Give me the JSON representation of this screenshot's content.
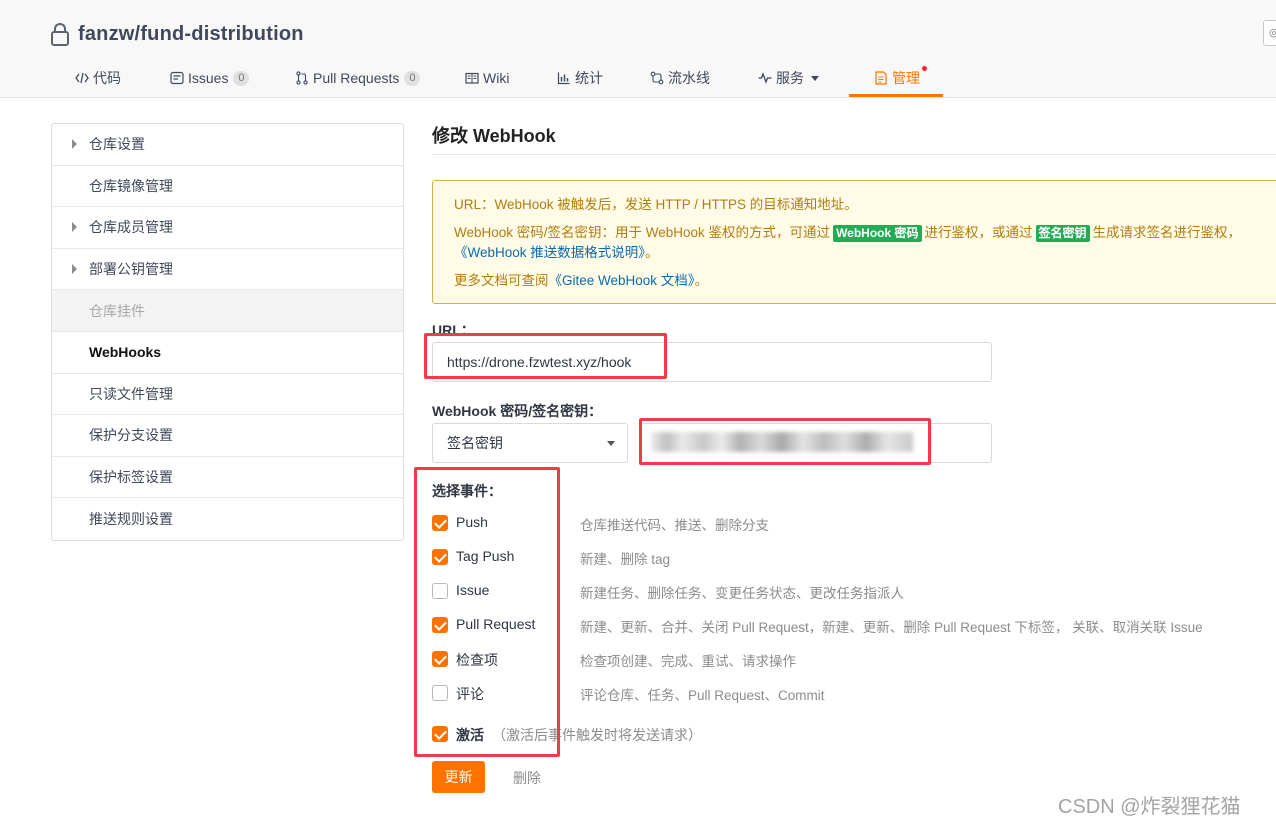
{
  "repo": {
    "name": "fanzw/fund-distribution"
  },
  "top_right": {
    "glyph": "◎"
  },
  "nav": [
    {
      "label": "代码",
      "icon": "code-icon"
    },
    {
      "label": "Issues",
      "icon": "issues-icon",
      "badge": "0"
    },
    {
      "label": "Pull Requests",
      "icon": "pull-request-icon",
      "badge": "0"
    },
    {
      "label": "Wiki",
      "icon": "wiki-icon"
    },
    {
      "label": "统计",
      "icon": "stats-icon"
    },
    {
      "label": "流水线",
      "icon": "pipeline-icon"
    },
    {
      "label": "服务",
      "icon": "service-icon"
    },
    {
      "label": "管理",
      "icon": "manage-icon"
    }
  ],
  "colors": {
    "accent": "#fe7300",
    "highlight_box": "#ef3b4a",
    "badge_green": "#22ad55"
  },
  "sidebar": [
    {
      "label": "仓库设置"
    },
    {
      "label": "仓库镜像管理"
    },
    {
      "label": "仓库成员管理"
    },
    {
      "label": "部署公钥管理"
    },
    {
      "label": "仓库挂件"
    },
    {
      "label": "WebHooks"
    },
    {
      "label": "只读文件管理"
    },
    {
      "label": "保护分支设置"
    },
    {
      "label": "保护标签设置"
    },
    {
      "label": "推送规则设置"
    }
  ],
  "main": {
    "title": "修改 WebHook",
    "notice": {
      "line1": "URL：WebHook 被触发后，发送 HTTP / HTTPS 的目标通知地址。",
      "line2_a": "WebHook 密码/签名密钥：用于 WebHook 鉴权的方式，可通过",
      "badge1": "WebHook 密码",
      "line2_b": "进行鉴权，或通过",
      "badge2": "签名密钥",
      "line2_c": "生成请求签名进行鉴权，",
      "line2_link": "《WebHook 推送数据格式说明》",
      "line2_end": "。",
      "line3_a": "更多文档可查阅",
      "line3_link": "《Gitee WebHook 文档》",
      "line3_end": "。"
    },
    "url_label": "URL：",
    "url_value": "https://drone.fzwtest.xyz/hook",
    "secret_label": "WebHook 密码/签名密钥：",
    "secret_type": "签名密钥",
    "events_label": "选择事件：",
    "events": [
      {
        "name": "Push",
        "desc": "仓库推送代码、推送、删除分支",
        "checked": true
      },
      {
        "name": "Tag Push",
        "desc": "新建、删除 tag",
        "checked": true
      },
      {
        "name": "Issue",
        "desc": "新建任务、删除任务、变更任务状态、更改任务指派人",
        "checked": false
      },
      {
        "name": "Pull Request",
        "desc": "新建、更新、合并、关闭 Pull Request，新建、更新、删除 Pull Request 下标签， 关联、取消关联 Issue",
        "checked": true
      },
      {
        "name": "检查项",
        "desc": "检查项创建、完成、重试、请求操作",
        "checked": true
      },
      {
        "name": "评论",
        "desc": "评论仓库、任务、Pull Request、Commit",
        "checked": false
      }
    ],
    "activate": {
      "label": "激活",
      "note": "（激活后事件触发时将发送请求）",
      "checked": true
    },
    "update_button": "更新",
    "delete_button": "删除"
  },
  "watermark": "CSDN @炸裂狸花猫"
}
